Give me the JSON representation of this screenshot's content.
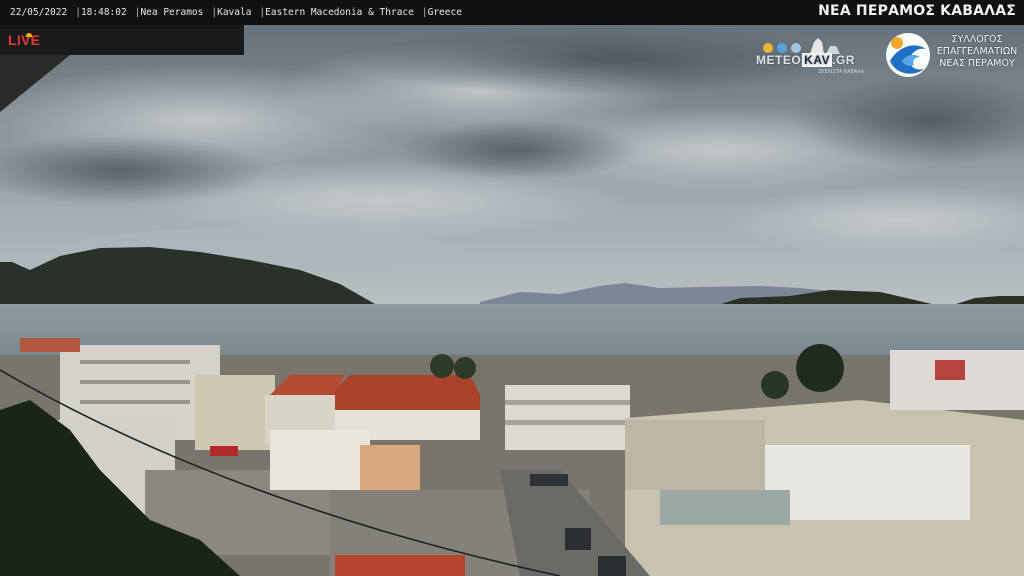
{
  "overlay": {
    "date": "22/05/2022",
    "time": "18:48:02",
    "location": [
      "Nea Peramos",
      "Kavala",
      "Eastern Macedonia & Thrace",
      "Greece"
    ],
    "separator": "|",
    "title": "ΝΕΑ ΠΕΡΑΜΟΣ ΚΑΒΑΛΑΣ",
    "live_label": "LIVE"
  },
  "logos": {
    "meteo_prefix": "METEO",
    "meteo_kav": "KAV",
    "meteo_suffix": ".GR",
    "meteo_subtitle": "ΣΚΕΛΙΣΤΑ ΚΑΒΑΛΑ",
    "association_lines": [
      "ΣΥΛΛΟΓΟΣ",
      "ΕΠΑΓΓΕΛΜΑΤΙΩΝ",
      "ΝΕΑΣ ΠΕΡΑΜΟΥ"
    ]
  },
  "colors": {
    "overlay_bar": "#111111",
    "live_red": "#e03a2e",
    "logo_blue": "#1f6fc4"
  }
}
